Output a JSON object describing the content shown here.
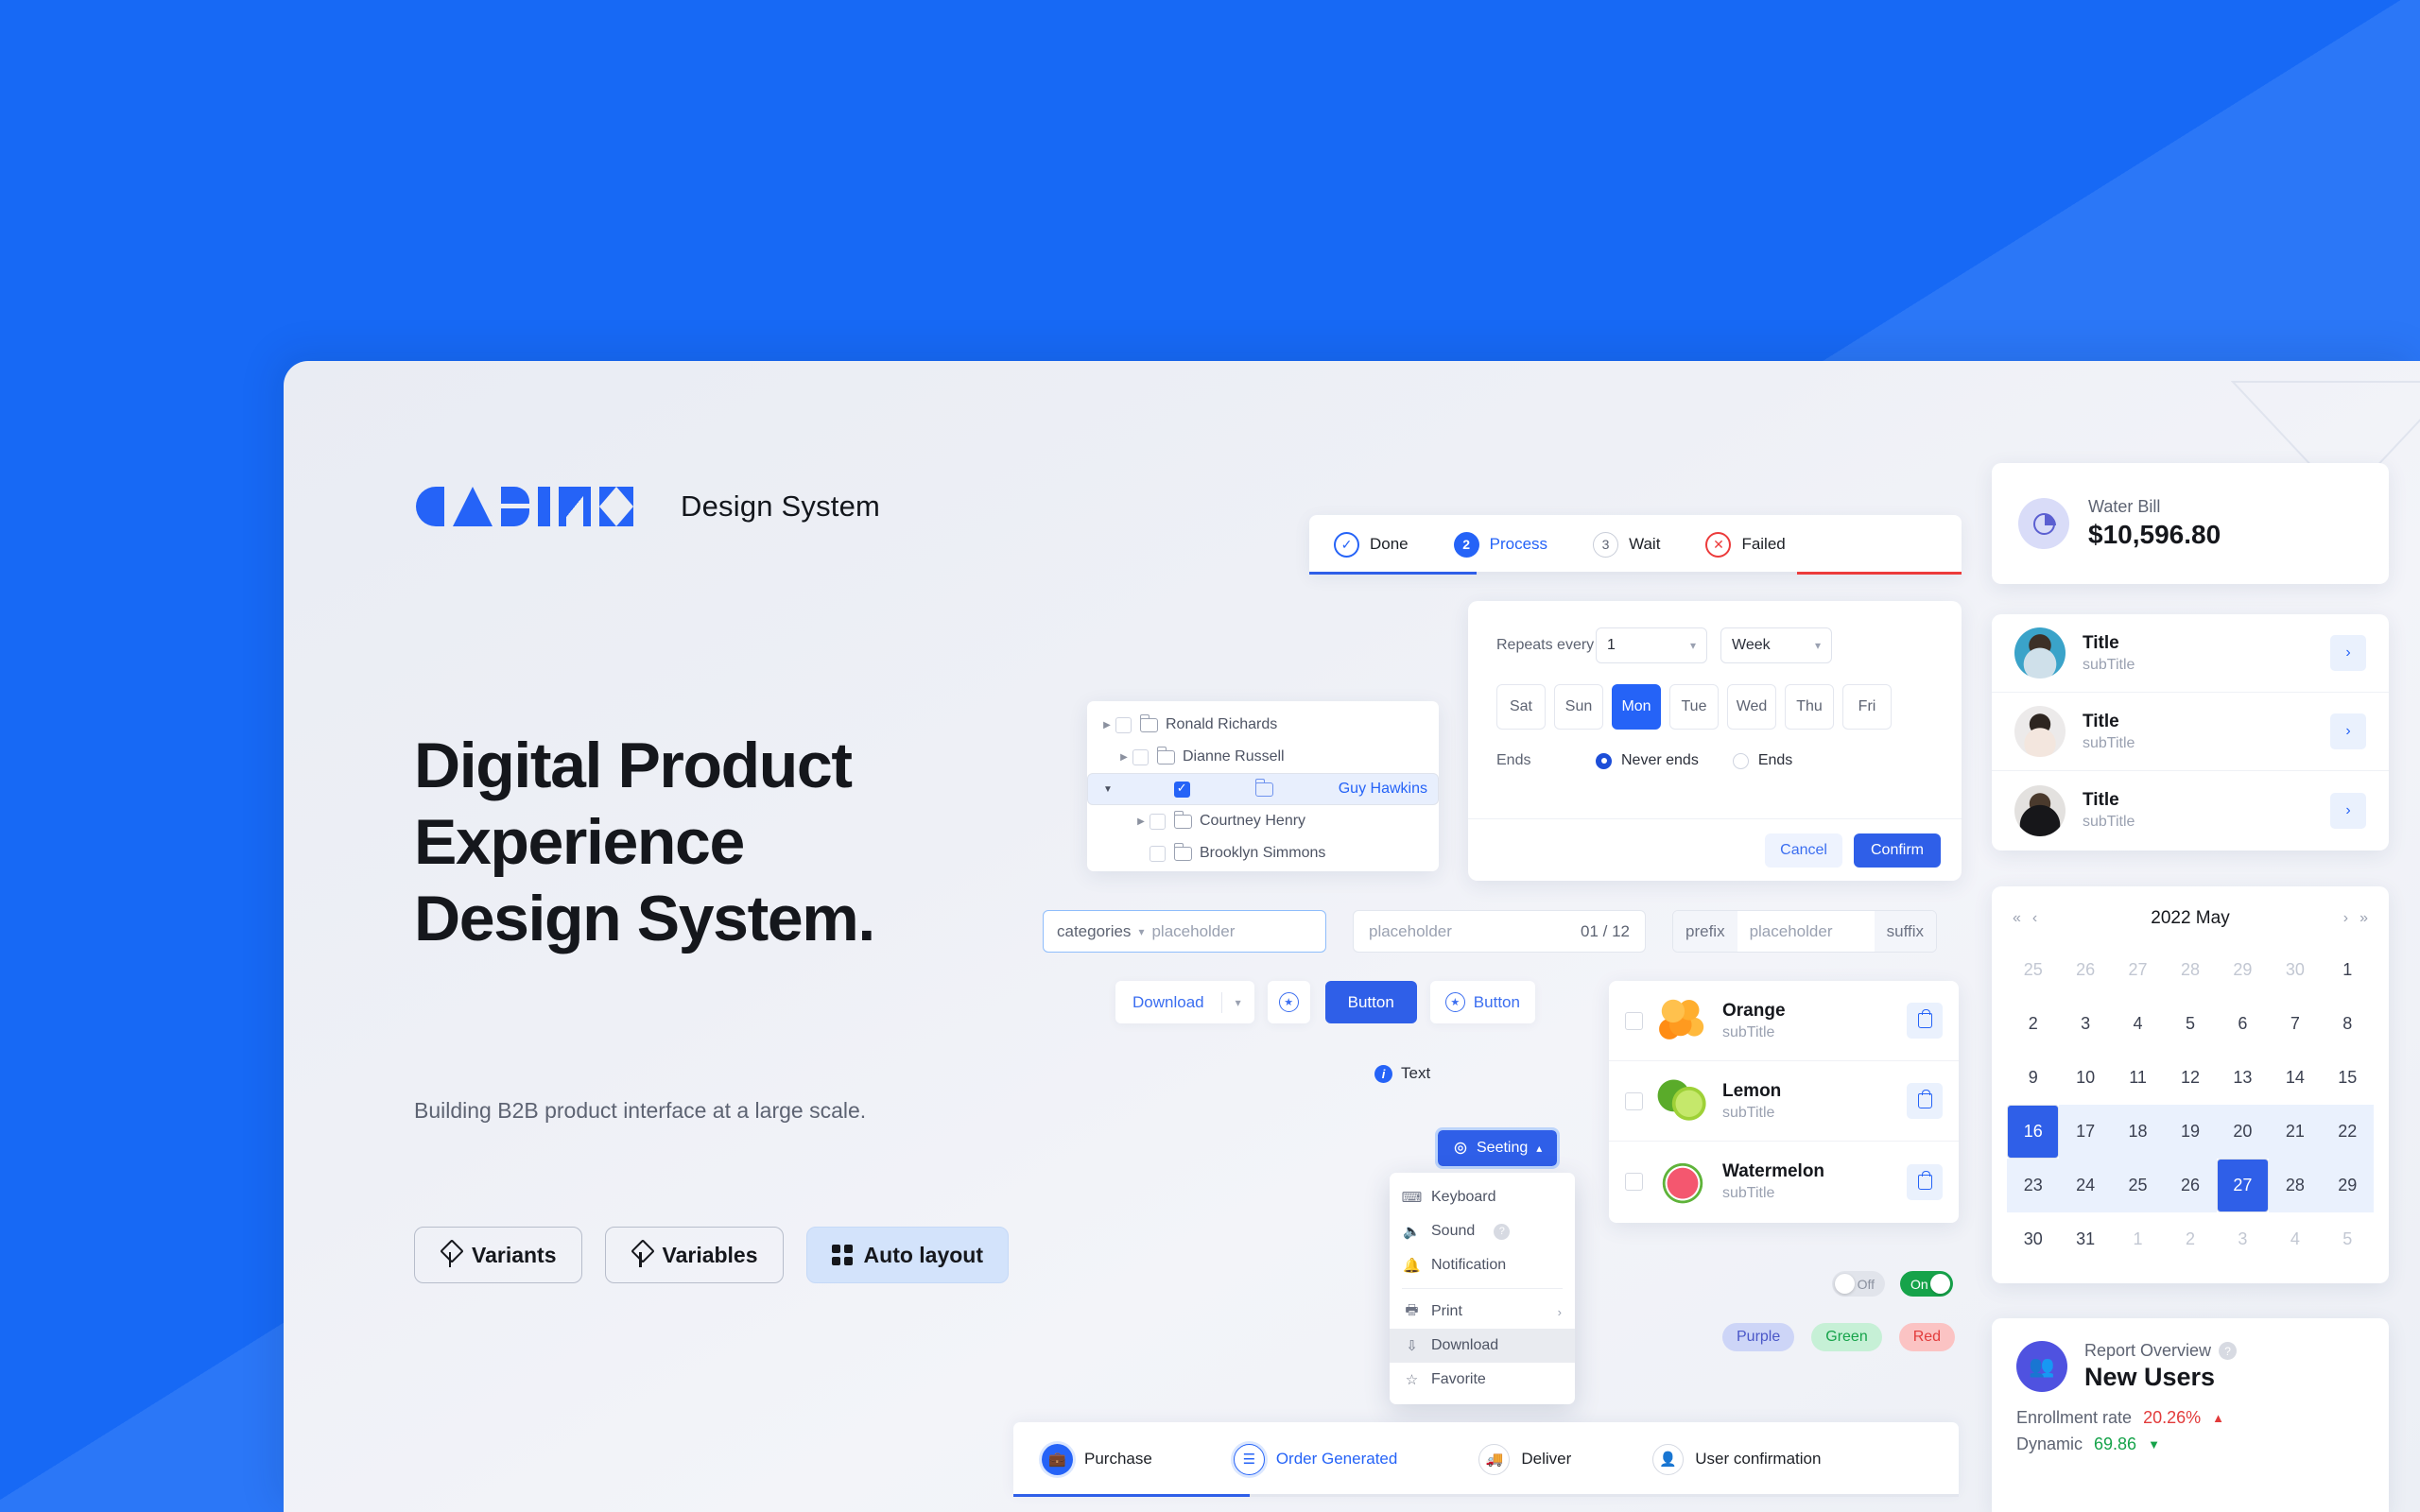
{
  "brand": {
    "logo_text": "CABIN X",
    "suffix": "Design System"
  },
  "hero": {
    "line1": "Digital Product",
    "line2": "Experience",
    "line3": "Design System.",
    "subtitle": "Building B2B product interface at a large scale.",
    "buttons": [
      {
        "label": "Variants",
        "icon": "variant-icon"
      },
      {
        "label": "Variables",
        "icon": "variant-icon"
      },
      {
        "label": "Auto layout",
        "icon": "grid-icon"
      }
    ]
  },
  "steps_top": {
    "items": [
      {
        "label": "Done",
        "badge": "✓",
        "state": "done"
      },
      {
        "label": "Process",
        "badge": "2",
        "state": "process"
      },
      {
        "label": "Wait",
        "badge": "3",
        "state": "wait"
      },
      {
        "label": "Failed",
        "badge": "✕",
        "state": "failed"
      }
    ]
  },
  "repeat": {
    "label": "Repeats every",
    "count": "1",
    "unit": "Week",
    "days": [
      {
        "label": "Sat",
        "selected": false
      },
      {
        "label": "Sun",
        "selected": false
      },
      {
        "label": "Mon",
        "selected": true
      },
      {
        "label": "Tue",
        "selected": false
      },
      {
        "label": "Wed",
        "selected": false
      },
      {
        "label": "Thu",
        "selected": false
      },
      {
        "label": "Fri",
        "selected": false
      }
    ],
    "ends_label": "Ends",
    "never_ends": "Never ends",
    "ends_option": "Ends",
    "cancel": "Cancel",
    "confirm": "Confirm"
  },
  "tree": {
    "nodes": [
      {
        "label": "Ronald Richards",
        "indent": 0,
        "arrow": "▶",
        "checked": false,
        "selected": false
      },
      {
        "label": "Dianne Russell",
        "indent": 1,
        "arrow": "▶",
        "checked": false,
        "selected": false
      },
      {
        "label": "Guy Hawkins",
        "indent": 0,
        "arrow": "▼",
        "checked": true,
        "selected": true
      },
      {
        "label": "Courtney Henry",
        "indent": 2,
        "arrow": "▶",
        "checked": false,
        "selected": false
      },
      {
        "label": "Brooklyn Simmons",
        "indent": 2,
        "arrow": "",
        "checked": false,
        "selected": false
      }
    ]
  },
  "inputs": {
    "category_select": "categories",
    "category_placeholder": "placeholder",
    "plain_placeholder": "placeholder",
    "counter": "01 / 12",
    "prefix": "prefix",
    "affix_placeholder": "placeholder",
    "suffix": "suffix"
  },
  "buttons_row": {
    "download": "Download",
    "solid": "Button",
    "ghost": "Button"
  },
  "text_chip": {
    "label": "Text"
  },
  "setting": {
    "button_label": "Seeting",
    "menu": [
      {
        "label": "Keyboard",
        "icon": "keyboard-icon",
        "highlight": false,
        "submenu": false,
        "help": false
      },
      {
        "label": "Sound",
        "icon": "sound-icon",
        "highlight": false,
        "submenu": false,
        "help": true
      },
      {
        "label": "Notification",
        "icon": "bell-icon",
        "highlight": false,
        "submenu": false,
        "help": false
      },
      {
        "label": "Print",
        "icon": "printer-icon",
        "highlight": false,
        "submenu": true,
        "help": false
      },
      {
        "label": "Download",
        "icon": "download-icon",
        "highlight": true,
        "submenu": false,
        "help": false
      },
      {
        "label": "Favorite",
        "icon": "star-icon",
        "highlight": false,
        "submenu": false,
        "help": false
      }
    ]
  },
  "fruits": [
    {
      "title": "Orange",
      "subtitle": "subTitle",
      "swatch": "orange"
    },
    {
      "title": "Lemon",
      "subtitle": "subTitle",
      "swatch": "lemon"
    },
    {
      "title": "Watermelon",
      "subtitle": "subTitle",
      "swatch": "melon"
    }
  ],
  "toggles": [
    {
      "label": "Off",
      "state": "off"
    },
    {
      "label": "On",
      "state": "on"
    }
  ],
  "tags": [
    {
      "label": "Purple",
      "color": "#4a57c8"
    },
    {
      "label": "Green",
      "color": "#16a34a"
    },
    {
      "label": "Red",
      "color": "#e23b3b"
    }
  ],
  "steps_bottom": {
    "items": [
      {
        "label": "Purchase",
        "icon": "bag-icon",
        "state": "active"
      },
      {
        "label": "Order Generated",
        "icon": "receipt-icon",
        "state": "ring"
      },
      {
        "label": "Deliver",
        "icon": "truck-icon",
        "state": "plain"
      },
      {
        "label": "User confirmation",
        "icon": "user-check-icon",
        "state": "plain"
      }
    ]
  },
  "bill": {
    "label": "Water Bill",
    "value": "$10,596.80",
    "icon": "pie-chart-icon"
  },
  "people": [
    {
      "title": "Title",
      "subtitle": "subTitle"
    },
    {
      "title": "Title",
      "subtitle": "subTitle"
    },
    {
      "title": "Title",
      "subtitle": "subTitle"
    }
  ],
  "calendar": {
    "title": "2022 May",
    "nav": {
      "first": "«",
      "prev": "‹",
      "next": "›",
      "last": "»"
    },
    "days": [
      {
        "d": "25",
        "mute": true
      },
      {
        "d": "26",
        "mute": true
      },
      {
        "d": "27",
        "mute": true
      },
      {
        "d": "28",
        "mute": true
      },
      {
        "d": "29",
        "mute": true
      },
      {
        "d": "30",
        "mute": true
      },
      {
        "d": "1",
        "mute": false
      },
      {
        "d": "2"
      },
      {
        "d": "3"
      },
      {
        "d": "4"
      },
      {
        "d": "5"
      },
      {
        "d": "6"
      },
      {
        "d": "7"
      },
      {
        "d": "8"
      },
      {
        "d": "9"
      },
      {
        "d": "10"
      },
      {
        "d": "11"
      },
      {
        "d": "12"
      },
      {
        "d": "13"
      },
      {
        "d": "14"
      },
      {
        "d": "15"
      },
      {
        "d": "16",
        "sel": true
      },
      {
        "d": "17",
        "range": true
      },
      {
        "d": "18",
        "range": true
      },
      {
        "d": "19",
        "range": true
      },
      {
        "d": "20",
        "range": true
      },
      {
        "d": "21",
        "range": true
      },
      {
        "d": "22",
        "range": true
      },
      {
        "d": "23",
        "range": true
      },
      {
        "d": "24",
        "range": true
      },
      {
        "d": "25",
        "range": true
      },
      {
        "d": "26",
        "range": true
      },
      {
        "d": "27",
        "sel": true
      },
      {
        "d": "28",
        "range": true
      },
      {
        "d": "29",
        "range": true
      },
      {
        "d": "30"
      },
      {
        "d": "31"
      },
      {
        "d": "1",
        "mute": true
      },
      {
        "d": "2",
        "mute": true
      },
      {
        "d": "3",
        "mute": true
      },
      {
        "d": "4",
        "mute": true
      },
      {
        "d": "5",
        "mute": true
      }
    ]
  },
  "report": {
    "label": "Report Overview",
    "title": "New Users",
    "stat1_label": "Enrollment rate",
    "stat1_value": "20.26%",
    "stat1_dir": "up",
    "stat2_label": "Dynamic",
    "stat2_value": "69.86",
    "stat2_dir": "down",
    "icon": "people-icon"
  },
  "colors": {
    "brand_blue": "#2563f7",
    "bg_blue": "#1769f5",
    "bg_blue_light": "#2b77f7",
    "card_bg": "#eceff5",
    "danger": "#ec3b3b",
    "success": "#16a34a"
  }
}
